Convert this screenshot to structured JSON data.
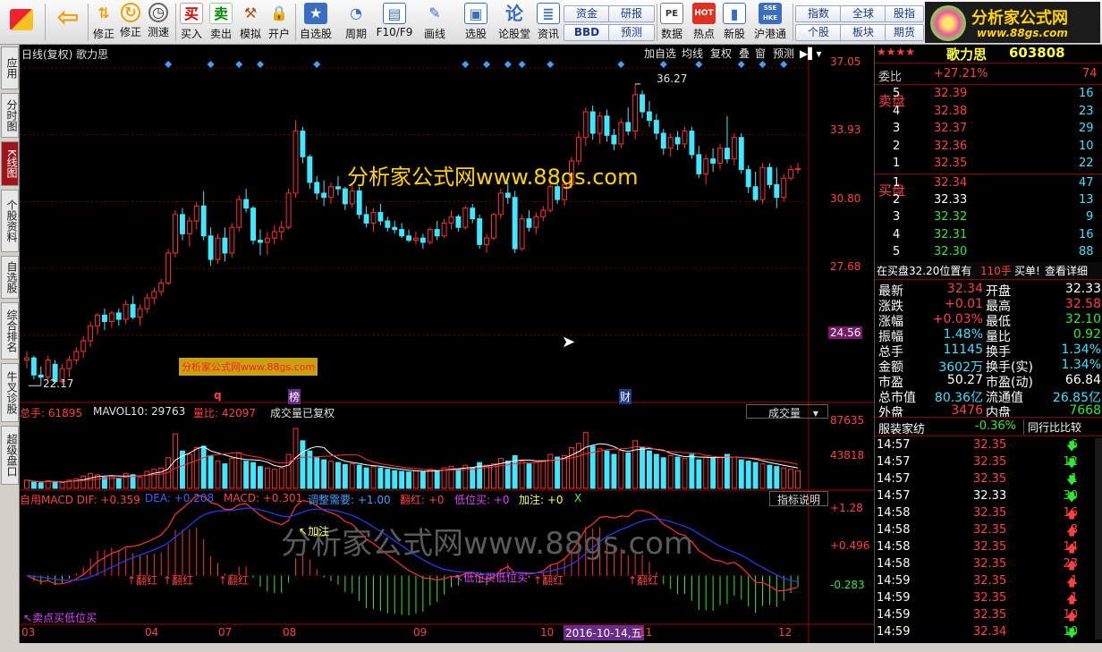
{
  "toolbar": {
    "buttons": [
      {
        "label": "",
        "icon": "app-grid-icon"
      },
      {
        "label": "",
        "icon": "back-arrow-icon"
      },
      {
        "label": "修正",
        "icon": "fix-icon"
      },
      {
        "label": "测速",
        "icon": "speed-test-icon"
      },
      {
        "label": "买入",
        "icon": "buy-icon",
        "glyph": "买"
      },
      {
        "label": "卖出",
        "icon": "sell-icon",
        "glyph": "卖"
      },
      {
        "label": "模拟",
        "icon": "simulate-icon"
      },
      {
        "label": "开户",
        "icon": "lock-icon"
      },
      {
        "label": "自选股",
        "icon": "star-icon"
      },
      {
        "label": "周期",
        "icon": "clock-icon"
      },
      {
        "label": "F10/F9",
        "icon": "f10-icon"
      },
      {
        "label": "画线",
        "icon": "pencil-icon"
      },
      {
        "label": "选股",
        "icon": "screen-icon"
      },
      {
        "label": "论股堂",
        "icon": "forum-icon"
      },
      {
        "label": "资讯",
        "icon": "news-icon"
      },
      {
        "label": "数据",
        "icon": "pe-icon",
        "glyph": "PE"
      },
      {
        "label": "热点",
        "icon": "hot-icon",
        "glyph": "HOT"
      },
      {
        "label": "新股",
        "icon": "ipo-icon"
      },
      {
        "label": "沪港通",
        "icon": "shhk-icon",
        "glyph": "SSE HKE"
      }
    ],
    "small_buttons": [
      "资金",
      "研报",
      "BBD",
      "预测",
      "指数",
      "全球",
      "股指",
      "个股",
      "板块",
      "期货"
    ]
  },
  "logo": {
    "title": "分析家公式网",
    "url": "www.88gs.com"
  },
  "left_tabs": [
    "应用",
    "分时图",
    "K线图",
    "个股资料",
    "自选股",
    "综合排名",
    "牛叉诊股",
    "超级盘口"
  ],
  "chart": {
    "header_left": "日线(复权)  歌力思",
    "header_buttons": [
      "加自选",
      "均线",
      "复权",
      "叠",
      "窗",
      "预测"
    ],
    "price_axis": [
      "37.05",
      "33.93",
      "30.80",
      "27.68",
      "24.56"
    ],
    "current_price_tag": "24.56",
    "high_label": "36.27",
    "low_label": "22.17",
    "watermark_main": "分析家公式网www.88gs.com",
    "watermark_small": "分析家公式网www.88gs.com",
    "watermark_big": "分析家公式网www.88gs.com",
    "event_markers": [
      "q",
      "榜",
      "财"
    ],
    "volume_header": {
      "total": "总手: 61895",
      "mavol": "MAVOL10: 29763",
      "ratio": "量比: 42097",
      "note": "成交量已复权",
      "selector": "成交量"
    },
    "volume_axis": [
      "87635",
      "43818"
    ],
    "macd_header": {
      "dif": "自用MACD DIF: +0.359",
      "dea": "DEA: +0.208",
      "macd": "MACD: +0.301",
      "adjust": "调整需要: +1.00",
      "fanhong": "翻红: +0",
      "dibuy": "低位买: +0",
      "jiazhu": "加注: +0",
      "x": "X",
      "help_button": "指标说明"
    },
    "macd_axis": [
      "+1.28",
      "+0.496",
      "-0.283"
    ],
    "macd_annotations": [
      "加注",
      "翻红",
      "翻红",
      "翻红",
      "低位买低位买",
      "翻红",
      "翻红",
      "卖点买低位买"
    ],
    "date_axis": [
      "03",
      "04",
      "07",
      "08",
      "09",
      "10",
      "11",
      "12"
    ],
    "date_highlight": "2016-10-14,五"
  },
  "chart_data": {
    "type": "candlestick",
    "title": "日线(复权) 歌力思",
    "ylim": [
      21.5,
      37.3
    ],
    "candles": [
      [
        23.4,
        23.8,
        23.0,
        23.5
      ],
      [
        23.5,
        23.6,
        22.5,
        22.7
      ],
      [
        22.7,
        23.1,
        22.2,
        22.6
      ],
      [
        22.6,
        23.6,
        22.5,
        23.4
      ],
      [
        23.2,
        23.4,
        22.3,
        22.4
      ],
      [
        22.4,
        23.2,
        22.3,
        23.0
      ],
      [
        23.0,
        23.6,
        22.6,
        23.4
      ],
      [
        23.4,
        24.0,
        23.2,
        23.8
      ],
      [
        23.8,
        24.5,
        23.5,
        24.3
      ],
      [
        24.3,
        25.2,
        24.0,
        25.0
      ],
      [
        25.0,
        25.6,
        24.6,
        25.5
      ],
      [
        25.5,
        25.8,
        24.8,
        25.2
      ],
      [
        25.2,
        25.7,
        24.9,
        25.6
      ],
      [
        25.6,
        25.8,
        25.0,
        25.3
      ],
      [
        25.3,
        26.2,
        25.1,
        26.0
      ],
      [
        26.0,
        26.4,
        25.3,
        25.4
      ],
      [
        25.4,
        26.0,
        25.0,
        25.8
      ],
      [
        25.8,
        26.5,
        25.6,
        26.3
      ],
      [
        26.3,
        26.8,
        26.0,
        26.6
      ],
      [
        26.6,
        27.2,
        26.4,
        27.0
      ],
      [
        27.0,
        28.6,
        26.9,
        28.4
      ],
      [
        28.4,
        30.4,
        28.2,
        30.2
      ],
      [
        30.2,
        30.5,
        29.0,
        29.3
      ],
      [
        29.3,
        30.1,
        28.7,
        29.9
      ],
      [
        29.9,
        30.8,
        29.5,
        30.6
      ],
      [
        30.6,
        31.3,
        29.0,
        29.2
      ],
      [
        29.2,
        29.6,
        27.8,
        28.1
      ],
      [
        28.1,
        29.3,
        27.9,
        29.1
      ],
      [
        29.1,
        29.6,
        28.0,
        28.4
      ],
      [
        28.4,
        29.8,
        28.2,
        29.6
      ],
      [
        29.6,
        31.1,
        29.4,
        30.9
      ],
      [
        30.9,
        31.4,
        30.3,
        30.5
      ],
      [
        30.5,
        30.6,
        28.8,
        29.0
      ],
      [
        29.0,
        29.5,
        28.3,
        28.9
      ],
      [
        28.9,
        29.4,
        28.3,
        29.1
      ],
      [
        29.1,
        29.7,
        28.8,
        29.4
      ],
      [
        29.4,
        29.9,
        29.0,
        29.6
      ],
      [
        29.6,
        31.4,
        29.5,
        31.2
      ],
      [
        31.2,
        34.6,
        31.0,
        34.1
      ],
      [
        34.1,
        34.3,
        32.6,
        32.9
      ],
      [
        32.9,
        33.0,
        31.4,
        31.7
      ],
      [
        31.7,
        32.0,
        30.9,
        31.2
      ],
      [
        31.2,
        31.8,
        30.6,
        31.0
      ],
      [
        31.0,
        31.7,
        30.7,
        31.5
      ],
      [
        31.5,
        32.0,
        31.1,
        31.4
      ],
      [
        31.4,
        31.5,
        30.4,
        30.7
      ],
      [
        30.7,
        31.6,
        30.5,
        31.3
      ],
      [
        31.3,
        31.5,
        30.0,
        30.2
      ],
      [
        30.2,
        30.6,
        29.6,
        29.8
      ],
      [
        29.8,
        30.5,
        29.4,
        30.3
      ],
      [
        30.3,
        30.7,
        29.7,
        29.9
      ],
      [
        29.9,
        30.1,
        29.4,
        29.6
      ],
      [
        29.6,
        29.9,
        29.3,
        29.5
      ],
      [
        29.5,
        29.8,
        29.1,
        29.2
      ],
      [
        29.2,
        29.5,
        28.9,
        29.0
      ],
      [
        29.0,
        29.4,
        28.8,
        29.1
      ],
      [
        29.1,
        29.3,
        28.6,
        28.9
      ],
      [
        28.9,
        29.6,
        28.8,
        29.5
      ],
      [
        29.5,
        29.9,
        29.0,
        29.2
      ],
      [
        29.2,
        30.0,
        29.1,
        29.8
      ],
      [
        29.8,
        30.4,
        29.5,
        30.1
      ],
      [
        30.1,
        30.2,
        29.4,
        29.6
      ],
      [
        29.6,
        30.6,
        29.5,
        30.5
      ],
      [
        30.5,
        30.7,
        29.8,
        30.0
      ],
      [
        30.0,
        30.2,
        28.6,
        28.8
      ],
      [
        28.8,
        29.3,
        28.4,
        29.1
      ],
      [
        29.1,
        30.3,
        29.0,
        30.2
      ],
      [
        30.2,
        31.4,
        30.0,
        31.2
      ],
      [
        31.2,
        31.7,
        30.7,
        31.0
      ],
      [
        31.0,
        31.3,
        28.4,
        28.6
      ],
      [
        28.6,
        30.2,
        28.5,
        30.0
      ],
      [
        30.0,
        30.4,
        29.4,
        29.6
      ],
      [
        29.6,
        30.3,
        29.3,
        30.1
      ],
      [
        30.1,
        30.6,
        29.9,
        30.4
      ],
      [
        30.4,
        31.7,
        30.3,
        31.5
      ],
      [
        31.5,
        32.1,
        30.7,
        30.9
      ],
      [
        30.9,
        31.8,
        30.6,
        31.6
      ],
      [
        31.6,
        32.9,
        31.4,
        32.7
      ],
      [
        32.7,
        34.1,
        32.5,
        33.8
      ],
      [
        33.8,
        35.2,
        33.4,
        35.0
      ],
      [
        35.0,
        35.3,
        33.7,
        34.0
      ],
      [
        34.0,
        35.0,
        33.5,
        34.8
      ],
      [
        34.8,
        35.1,
        33.6,
        33.9
      ],
      [
        33.9,
        34.2,
        33.2,
        33.5
      ],
      [
        33.5,
        34.7,
        33.3,
        34.5
      ],
      [
        34.5,
        35.2,
        33.9,
        34.1
      ],
      [
        34.1,
        36.3,
        33.7,
        35.8
      ],
      [
        35.8,
        36.0,
        34.7,
        35.0
      ],
      [
        35.0,
        35.5,
        34.3,
        34.6
      ],
      [
        34.6,
        34.9,
        33.7,
        34.0
      ],
      [
        34.0,
        34.2,
        33.0,
        33.3
      ],
      [
        33.3,
        34.0,
        32.9,
        33.8
      ],
      [
        33.8,
        34.1,
        33.2,
        33.5
      ],
      [
        33.5,
        34.3,
        33.3,
        34.1
      ],
      [
        34.1,
        34.3,
        32.8,
        33.0
      ],
      [
        33.0,
        33.4,
        31.9,
        32.1
      ],
      [
        32.1,
        33.0,
        31.6,
        32.8
      ],
      [
        32.8,
        33.3,
        32.2,
        32.6
      ],
      [
        32.6,
        33.5,
        32.3,
        33.3
      ],
      [
        33.3,
        34.8,
        32.6,
        32.8
      ],
      [
        32.8,
        34.0,
        32.5,
        33.8
      ],
      [
        33.8,
        34.0,
        32.1,
        32.3
      ],
      [
        32.3,
        32.5,
        31.2,
        31.5
      ],
      [
        31.5,
        32.2,
        30.8,
        30.9
      ],
      [
        30.9,
        32.6,
        30.7,
        32.4
      ],
      [
        32.4,
        32.6,
        31.4,
        31.6
      ],
      [
        31.6,
        32.4,
        30.5,
        31.0
      ],
      [
        31.0,
        32.1,
        30.8,
        31.9
      ],
      [
        31.9,
        32.5,
        31.8,
        32.3
      ],
      [
        32.3,
        32.6,
        32.1,
        32.34
      ]
    ],
    "volume_axis_max": 87635,
    "volume": [
      12,
      9,
      8,
      11,
      10,
      9,
      12,
      14,
      18,
      22,
      20,
      16,
      18,
      14,
      22,
      20,
      16,
      25,
      28,
      30,
      45,
      80,
      55,
      50,
      60,
      62,
      48,
      40,
      36,
      44,
      52,
      40,
      38,
      32,
      30,
      28,
      30,
      50,
      88,
      70,
      55,
      45,
      42,
      40,
      38,
      35,
      36,
      34,
      30,
      32,
      30,
      28,
      26,
      25,
      24,
      26,
      24,
      28,
      26,
      30,
      32,
      28,
      34,
      30,
      38,
      34,
      36,
      44,
      40,
      48,
      40,
      36,
      38,
      40,
      50,
      46,
      48,
      60,
      66,
      82,
      62,
      58,
      55,
      50,
      56,
      52,
      70,
      60,
      55,
      50,
      45,
      48,
      46,
      44,
      50,
      42,
      46,
      44,
      45,
      50,
      46,
      42,
      40,
      38,
      36,
      34,
      32,
      30,
      28,
      26
    ],
    "macd_ylim": [
      -0.9,
      1.35
    ]
  },
  "quote": {
    "stars": "★★★★",
    "name": "歌力思",
    "code": "603808",
    "weibi_label": "委比",
    "weibi": "+27.21%",
    "weicha": "74",
    "sell_label": "卖盘",
    "buy_label": "买盘",
    "sell": [
      {
        "lvl": "5",
        "price": "32.39",
        "vol": "16"
      },
      {
        "lvl": "4",
        "price": "32.38",
        "vol": "23"
      },
      {
        "lvl": "3",
        "price": "32.37",
        "vol": "29"
      },
      {
        "lvl": "2",
        "price": "32.36",
        "vol": "10"
      },
      {
        "lvl": "1",
        "price": "32.35",
        "vol": "22"
      }
    ],
    "buy": [
      {
        "lvl": "1",
        "price": "32.34",
        "vol": "47"
      },
      {
        "lvl": "2",
        "price": "32.33",
        "vol": "13"
      },
      {
        "lvl": "3",
        "price": "32.32",
        "vol": "9"
      },
      {
        "lvl": "4",
        "price": "32.31",
        "vol": "16"
      },
      {
        "lvl": "5",
        "price": "32.30",
        "vol": "88"
      }
    ],
    "order_note": "在买盘32.20位置有",
    "order_qty": "110手",
    "order_tag": "买单!",
    "order_link": "查看详细",
    "stats": [
      {
        "l": "最新",
        "v": "32.34",
        "c": "red",
        "l2": "开盘",
        "v2": "32.33",
        "c2": "white"
      },
      {
        "l": "涨跌",
        "v": "+0.01",
        "c": "red",
        "l2": "最高",
        "v2": "32.58",
        "c2": "red"
      },
      {
        "l": "涨幅",
        "v": "+0.03%",
        "c": "red",
        "l2": "最低",
        "v2": "32.10",
        "c2": "green"
      },
      {
        "l": "振幅",
        "v": "1.48%",
        "c": "cyan",
        "l2": "量比",
        "v2": "0.92",
        "c2": "green"
      },
      {
        "l": "总手",
        "v": "11145",
        "c": "cyan",
        "l2": "换手",
        "v2": "1.34%",
        "c2": "cyan"
      },
      {
        "l": "金额",
        "v": "3602万",
        "c": "cyan",
        "l2": "换手(实)",
        "v2": "1.34%",
        "c2": "cyan"
      },
      {
        "l": "市盈",
        "v": "50.27",
        "c": "white",
        "l2": "市盈(动)",
        "v2": "66.84",
        "c2": "white"
      },
      {
        "l": "总市值",
        "v": "80.36亿",
        "c": "cyan",
        "l2": "流通值",
        "v2": "26.85亿",
        "c2": "cyan"
      },
      {
        "l": "外盘",
        "v": "3476",
        "c": "red",
        "l2": "内盘",
        "v2": "7668",
        "c2": "green"
      }
    ],
    "sector": "服装家纺",
    "sector_change": "-0.36%",
    "compare_button": "同行比比较",
    "ticks": [
      {
        "t": "14:57",
        "p": "32.35",
        "v": "6",
        "d": "down"
      },
      {
        "t": "14:57",
        "p": "32.35",
        "v": "12",
        "d": "down"
      },
      {
        "t": "14:57",
        "p": "32.35",
        "v": "1",
        "d": "down"
      },
      {
        "t": "14:57",
        "p": "32.33",
        "v": "30",
        "d": "down"
      },
      {
        "t": "14:58",
        "p": "32.35",
        "v": "16",
        "d": "up"
      },
      {
        "t": "14:58",
        "p": "32.35",
        "v": "8",
        "d": "up"
      },
      {
        "t": "14:58",
        "p": "32.35",
        "v": "14",
        "d": "up"
      },
      {
        "t": "14:58",
        "p": "32.35",
        "v": "23",
        "d": "up"
      },
      {
        "t": "14:59",
        "p": "32.35",
        "v": "1",
        "d": "up"
      },
      {
        "t": "14:59",
        "p": "32.35",
        "v": "1",
        "d": "up"
      },
      {
        "t": "14:59",
        "p": "32.35",
        "v": "10",
        "d": "up"
      },
      {
        "t": "14:59",
        "p": "32.34",
        "v": "10",
        "d": "down"
      }
    ]
  }
}
